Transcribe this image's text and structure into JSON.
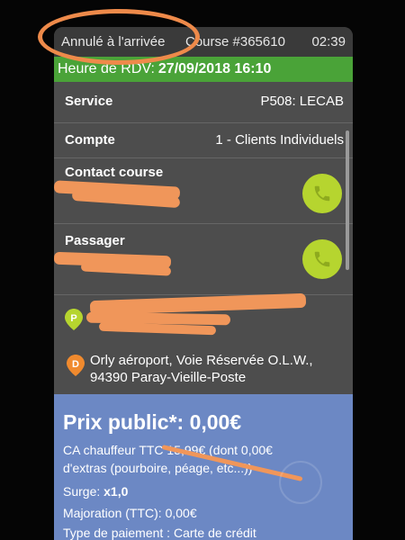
{
  "status_bar": {
    "ride_status": "Annulé à l'arrivée",
    "course_number": "Course #365610",
    "time": "02:39"
  },
  "rdv": {
    "label": "Heure de RDV:",
    "datetime": "27/09/2018 16:10"
  },
  "details": {
    "service_label": "Service",
    "service_value": "P508: LECAB",
    "account_label": "Compte",
    "account_value": "1 - Clients Individuels",
    "contact_label": "Contact course",
    "passenger_label": "Passager"
  },
  "addresses": {
    "pickup_marker": "P",
    "dropoff_marker": "D",
    "dropoff_line1": "Orly aéroport, Voie Réservée O.L.W.,",
    "dropoff_line2": "94390 Paray-Vieille-Poste"
  },
  "pricing": {
    "title": "Prix public*: 0,00€",
    "ca_line1": "CA chauffeur TTC 15,99€ (dont 0,00€",
    "ca_line2": "d'extras (pourboire, péage, etc...))",
    "surge_label": "Surge:",
    "surge_value": "x1,0",
    "majoration": "Majoration (TTC): 0,00€",
    "payment": "Type de paiement : Carte de crédit"
  },
  "colors": {
    "rdv_green": "#4aa338",
    "call_button": "#b6d52f",
    "price_panel": "#6c88c4",
    "annotation_orange": "#ee8a4a"
  },
  "icons": {
    "call": "phone-icon",
    "pickup": "map-pin-icon",
    "dropoff": "map-pin-icon"
  }
}
